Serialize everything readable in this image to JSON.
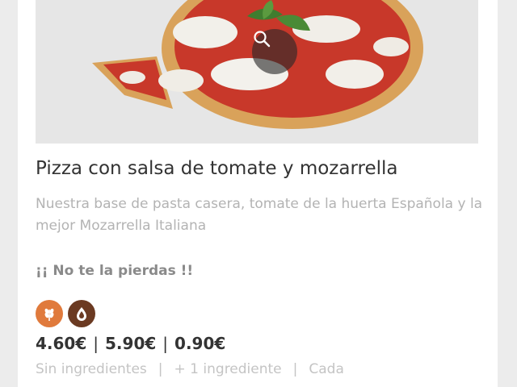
{
  "product": {
    "title": "Pizza con salsa de tomate y mozarrella",
    "description": "Nuestra base de pasta casera, tomate de la huerta Española y la mejor Mozarrella Italiana",
    "promo": "¡¡ No te la pierdas !!",
    "image_alt": "Pizza con salsa de tomate y mozarrella",
    "zoom_icon": "search-icon"
  },
  "allergens": [
    {
      "icon": "gluten-icon",
      "color": "#e07a3c"
    },
    {
      "icon": "dairy-icon",
      "color": "#6b3a22"
    }
  ],
  "prices": {
    "base": "4.60€",
    "extra": "5.90€",
    "each": "0.90€",
    "separator": "|"
  },
  "price_labels": {
    "base": "Sin ingredientes",
    "extra": "+ 1 ingrediente",
    "each": "Cada",
    "separator": "|"
  }
}
